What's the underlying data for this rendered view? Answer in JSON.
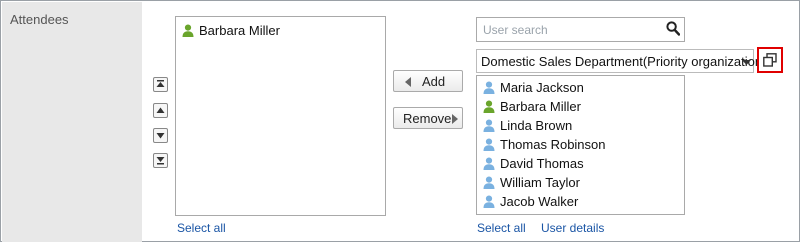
{
  "field_label": "Attendees",
  "selected_users": [
    {
      "name": "Barbara Miller",
      "icon": "user-icon",
      "color": "#6aa52c"
    }
  ],
  "order_buttons": [
    {
      "name": "move-to-top-button",
      "icon": "move-to-top-icon"
    },
    {
      "name": "move-up-button",
      "icon": "move-up-icon"
    },
    {
      "name": "move-down-button",
      "icon": "move-down-icon"
    },
    {
      "name": "move-to-bottom-button",
      "icon": "move-to-bottom-icon"
    }
  ],
  "add_label": "Add",
  "remove_label": "Remove",
  "search": {
    "placeholder": "User search",
    "icon": "search-icon"
  },
  "organization": {
    "selected": "Domestic Sales Department(Priority organization)",
    "icon": "chevron-down-icon"
  },
  "org_select_button_icon": "copy-windows-icon",
  "candidates": [
    {
      "name": "Maria Jackson",
      "color": "#7ab1e0"
    },
    {
      "name": "Barbara Miller",
      "color": "#6aa52c"
    },
    {
      "name": "Linda Brown",
      "color": "#7ab1e0"
    },
    {
      "name": "Thomas Robinson",
      "color": "#7ab1e0"
    },
    {
      "name": "David Thomas",
      "color": "#7ab1e0"
    },
    {
      "name": "William Taylor",
      "color": "#7ab1e0"
    },
    {
      "name": "Jacob Walker",
      "color": "#7ab1e0"
    }
  ],
  "links": {
    "select_all_selected": "Select all",
    "select_all_candidates": "Select all",
    "user_details": "User details"
  },
  "colors": {
    "highlight": "#e00000",
    "link": "#1a55a5",
    "label_bg": "#e8e8e8"
  }
}
